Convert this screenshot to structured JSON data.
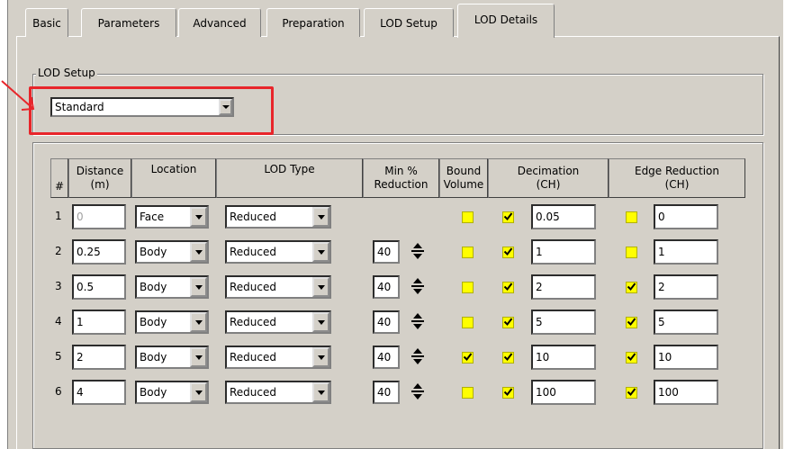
{
  "tabs": [
    "Basic",
    "Parameters",
    "Advanced",
    "Preparation",
    "LOD Setup",
    "LOD Details"
  ],
  "active_tab": 5,
  "lod_setup": {
    "legend": "LOD Setup",
    "value": "Standard"
  },
  "table": {
    "headers": {
      "num": "#",
      "distance": [
        "Distance",
        "(m)"
      ],
      "location": "Location",
      "lod_type": "LOD Type",
      "min_reduction": [
        "Min %",
        "Reduction"
      ],
      "bound_volume": [
        "Bound",
        "Volume"
      ],
      "decimation": [
        "Decimation",
        "(CH)"
      ],
      "edge_reduction": [
        "Edge Reduction",
        "(CH)"
      ]
    },
    "rows": [
      {
        "num": "1",
        "distance": "0",
        "location": "Face",
        "lod_type": "Reduced",
        "min_reduction": "",
        "bound": false,
        "dec_checked": true,
        "decimation": "0.05",
        "edge_checked": false,
        "edge": "0"
      },
      {
        "num": "2",
        "distance": "0.25",
        "location": "Body",
        "lod_type": "Reduced",
        "min_reduction": "40",
        "bound": false,
        "dec_checked": true,
        "decimation": "1",
        "edge_checked": false,
        "edge": "1"
      },
      {
        "num": "3",
        "distance": "0.5",
        "location": "Body",
        "lod_type": "Reduced",
        "min_reduction": "40",
        "bound": false,
        "dec_checked": true,
        "decimation": "2",
        "edge_checked": true,
        "edge": "2"
      },
      {
        "num": "4",
        "distance": "1",
        "location": "Body",
        "lod_type": "Reduced",
        "min_reduction": "40",
        "bound": false,
        "dec_checked": true,
        "decimation": "5",
        "edge_checked": true,
        "edge": "5"
      },
      {
        "num": "5",
        "distance": "2",
        "location": "Body",
        "lod_type": "Reduced",
        "min_reduction": "40",
        "bound": true,
        "dec_checked": true,
        "decimation": "10",
        "edge_checked": true,
        "edge": "10"
      },
      {
        "num": "6",
        "distance": "4",
        "location": "Body",
        "lod_type": "Reduced",
        "min_reduction": "40",
        "bound": false,
        "dec_checked": true,
        "decimation": "100",
        "edge_checked": true,
        "edge": "100"
      }
    ]
  },
  "colors": {
    "highlight": "#e8252a",
    "checkbox": "#ffff00",
    "panel": "#d4d0c8"
  },
  "icons": [
    "arrow-annotation-icon",
    "dropdown-arrow-icon",
    "spin-arrows-icon",
    "checkmark-icon"
  ]
}
